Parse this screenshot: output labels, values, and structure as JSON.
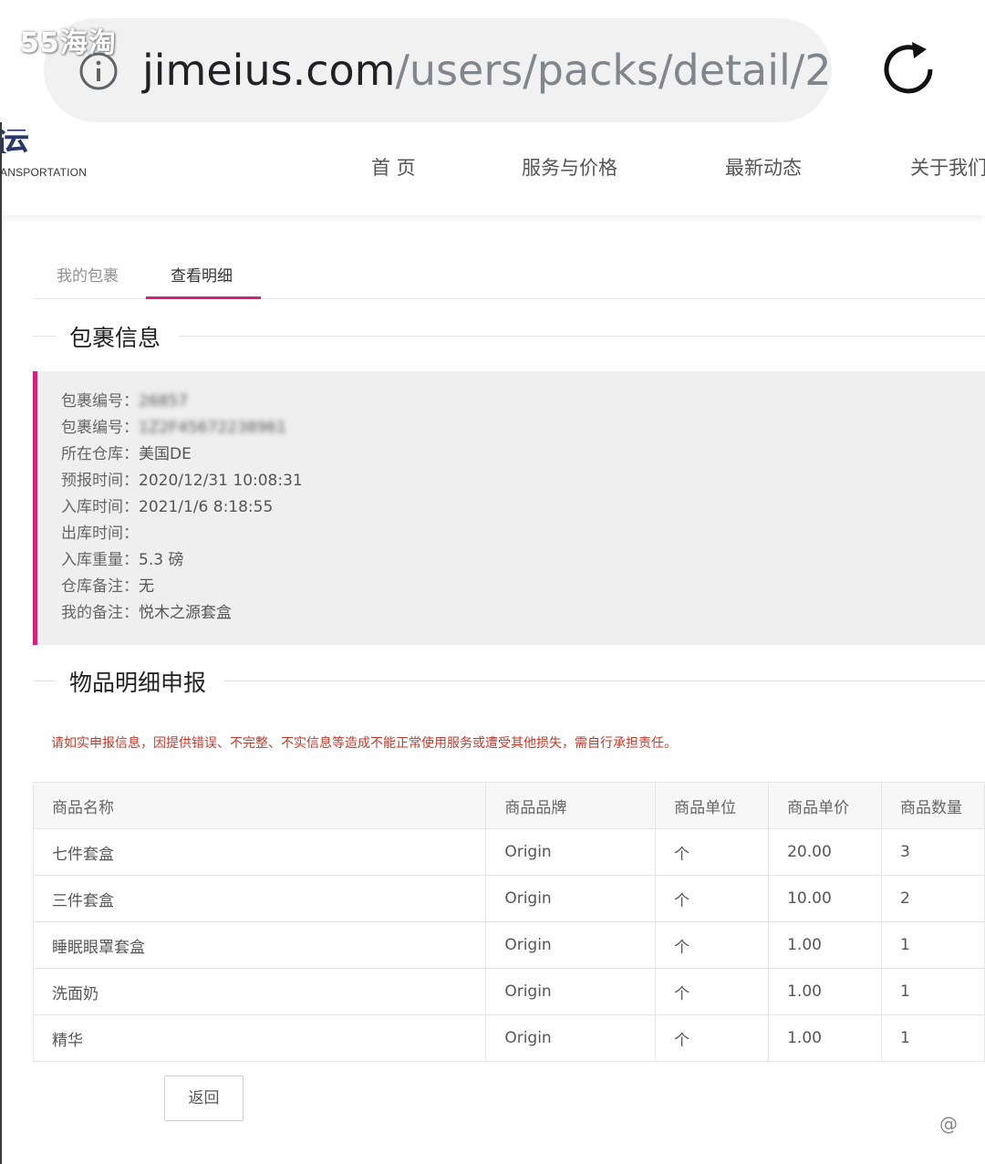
{
  "watermark": {
    "top": "55海淘",
    "bottom": "@"
  },
  "browser": {
    "url_domain": "jimeius.com",
    "url_path": "/users/packs/detail/2"
  },
  "header": {
    "logo_glyph": "运",
    "logo_sub": "ANSPORTATION",
    "nav": [
      "首 页",
      "服务与价格",
      "最新动态",
      "关于我们"
    ]
  },
  "tabs": [
    {
      "label": "我的包裹",
      "active": false
    },
    {
      "label": "查看明细",
      "active": true
    }
  ],
  "package_section": {
    "title": "包裹信息",
    "rows": [
      {
        "label": "包裹编号：",
        "value": "26857"
      },
      {
        "label": "包裹编号：",
        "value": "1Z2F45672238961"
      },
      {
        "label": "所在仓库：",
        "value": "美国DE"
      },
      {
        "label": "预报时间：",
        "value": "2020/12/31 10:08:31"
      },
      {
        "label": "入库时间：",
        "value": "2021/1/6 8:18:55"
      },
      {
        "label": "出库时间：",
        "value": ""
      },
      {
        "label": "入库重量：",
        "value": "5.3 磅"
      },
      {
        "label": "仓库备注：",
        "value": "无"
      },
      {
        "label": "我的备注：",
        "value": "悦木之源套盒"
      }
    ]
  },
  "items_section": {
    "title": "物品明细申报",
    "warning": "请如实申报信息，因提供错误、不完整、不实信息等造成不能正常使用服务或遭受其他损失，需自行承担责任。",
    "columns": [
      "商品名称",
      "商品品牌",
      "商品单位",
      "商品单价",
      "商品数量"
    ],
    "rows": [
      [
        "七件套盒",
        "Origin",
        "个",
        "20.00",
        "3"
      ],
      [
        "三件套盒",
        "Origin",
        "个",
        "10.00",
        "2"
      ],
      [
        "睡眠眼罩套盒",
        "Origin",
        "个",
        "1.00",
        "1"
      ],
      [
        "洗面奶",
        "Origin",
        "个",
        "1.00",
        "1"
      ],
      [
        "精华",
        "Origin",
        "个",
        "1.00",
        "1"
      ]
    ]
  },
  "back_button": "返回",
  "colors": {
    "accent": "#d6217c",
    "warning": "#c0392b",
    "logo": "#28386b"
  }
}
